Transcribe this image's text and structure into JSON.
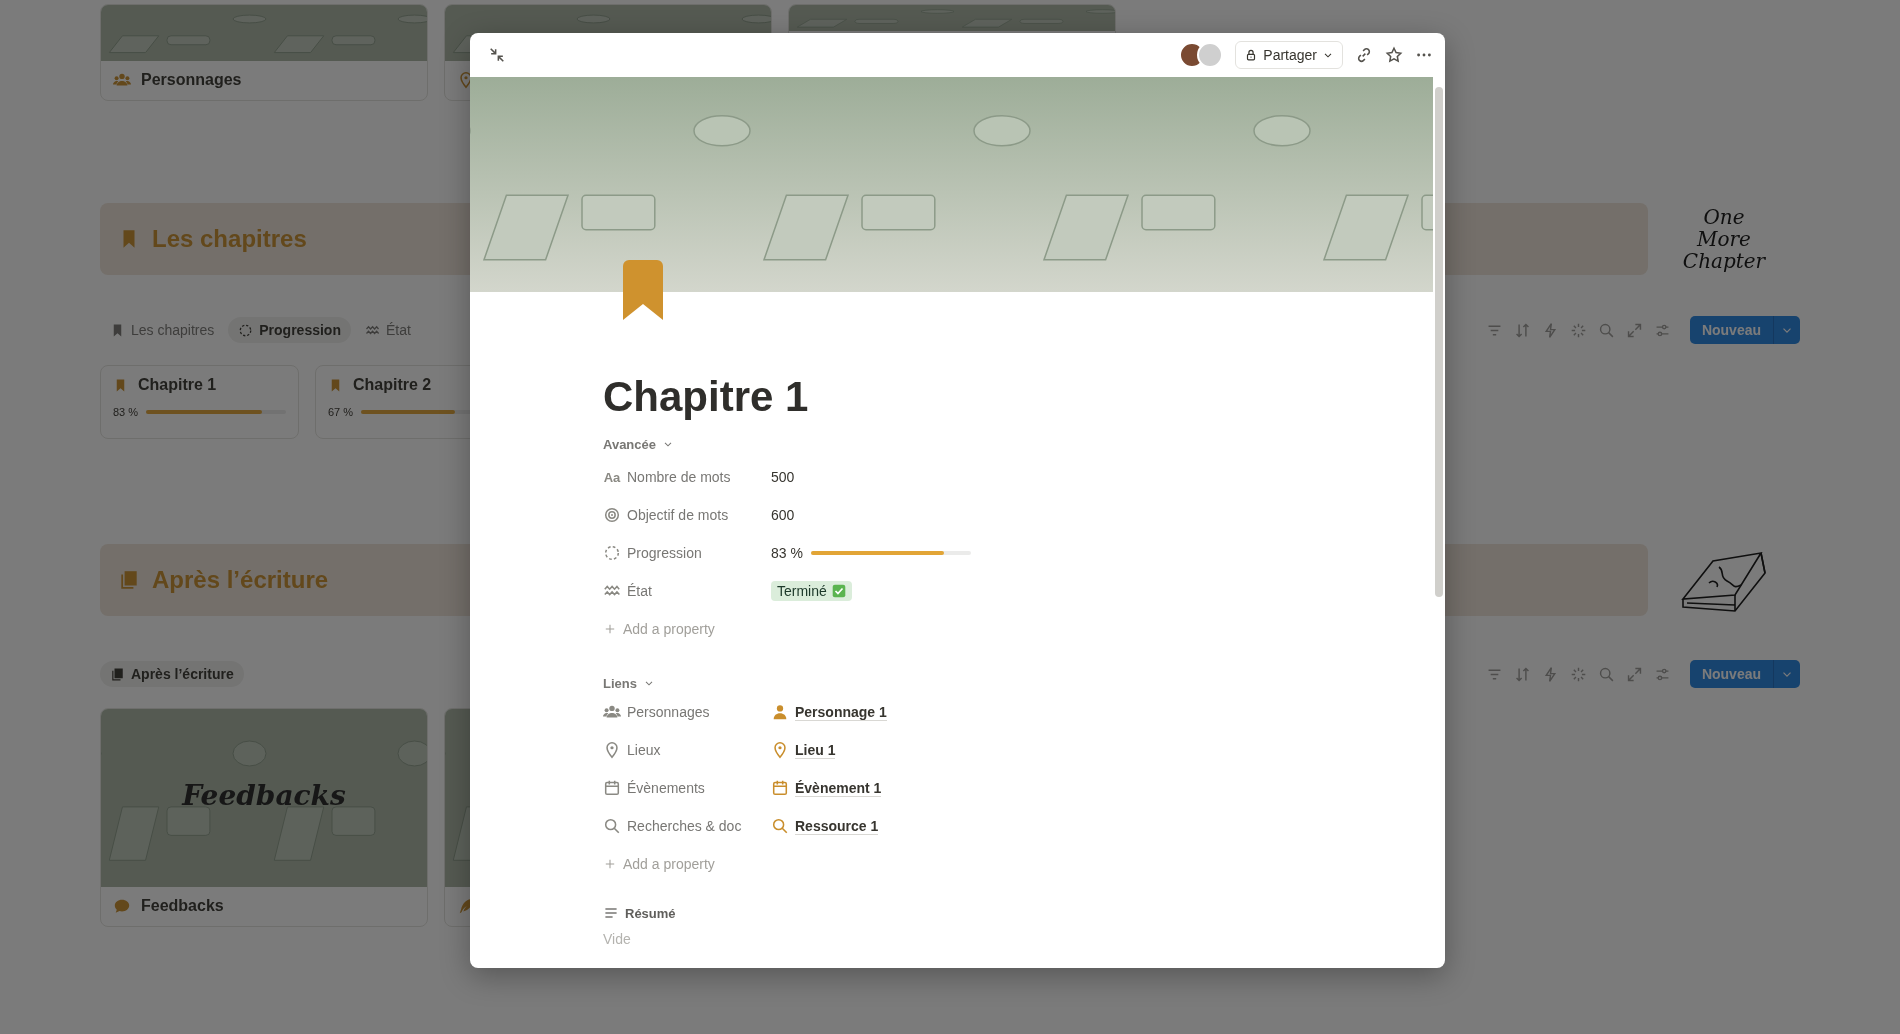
{
  "background": {
    "top_cards": [
      {
        "kind": "titled",
        "title": "Personnages"
      },
      {
        "kind": "untitled"
      },
      {
        "kind": "untitled"
      }
    ],
    "sections": [
      {
        "title": "Les chapitres",
        "logo_text": "One More Chapter",
        "new_button": "Nouveau",
        "views": [
          {
            "label": "Les chapitres",
            "selected": false
          },
          {
            "label": "Progression",
            "selected": true
          },
          {
            "label": "État",
            "selected": false
          }
        ],
        "cards": [
          {
            "title": "Chapitre 1",
            "reading": "83 %",
            "level": 0.83
          },
          {
            "title": "Chapitre 2",
            "reading": "67 %",
            "level": 0.67
          }
        ]
      },
      {
        "title": "Après l’écriture",
        "new_button": "Nouveau",
        "views": [
          {
            "label": "Après l’écriture",
            "selected": true
          }
        ],
        "cards": [
          {
            "kind": "titled",
            "title": "Feedbacks",
            "cover_title": "Feedbacks"
          },
          {
            "kind": "untitled"
          }
        ]
      }
    ]
  },
  "modal": {
    "share": "Partager",
    "title": "Chapitre 1",
    "groups": [
      {
        "title": "Avancée",
        "add_label": "Add a property",
        "properties": [
          {
            "kind": "text",
            "icon_glyph": "Aa",
            "label": "Nombre de mots",
            "value": "500"
          },
          {
            "kind": "text",
            "label": "Objectif de mots",
            "value": "600"
          },
          {
            "kind": "progress",
            "label": "Progression",
            "reading": "83 %",
            "level": 0.83
          },
          {
            "kind": "status",
            "label": "État",
            "value": "Terminé",
            "done": true
          }
        ]
      },
      {
        "title": "Liens",
        "add_label": "Add a property",
        "properties": [
          {
            "kind": "relation",
            "label": "Personnages",
            "value": "Personnage 1"
          },
          {
            "kind": "relation",
            "label": "Lieux",
            "value": "Lieu 1"
          },
          {
            "kind": "relation",
            "label": "Évènements",
            "value": "Évènement 1"
          },
          {
            "kind": "relation",
            "label": "Recherches & doc",
            "value": "Ressource 1"
          }
        ]
      }
    ],
    "summary": {
      "label": "Résumé",
      "placeholder": "Vide"
    }
  }
}
